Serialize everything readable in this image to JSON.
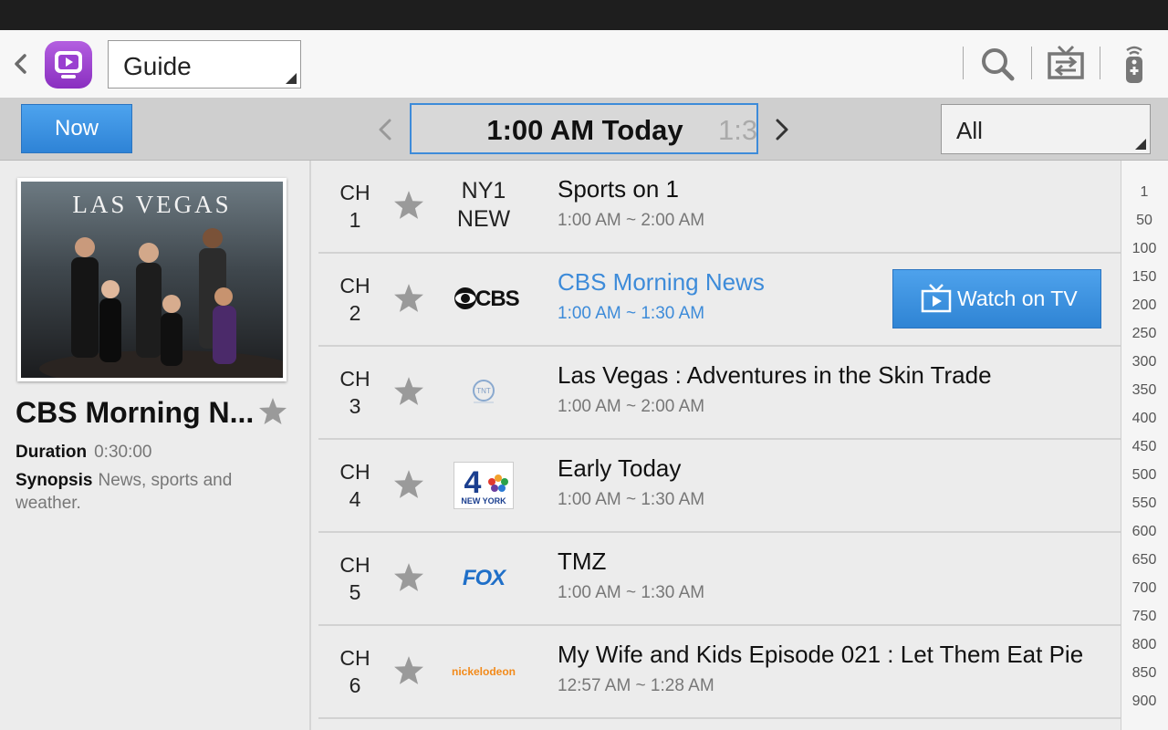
{
  "actionbar": {
    "view_select_value": "Guide"
  },
  "subbar": {
    "now_label": "Now",
    "current_time": "1:00 AM Today",
    "next_time_partial": "1:3",
    "filter_value": "All"
  },
  "detail": {
    "poster_title": "LAS VEGAS",
    "title": "CBS Morning N...",
    "duration_label": "Duration",
    "duration_value": "0:30:00",
    "synopsis_label": "Synopsis",
    "synopsis_value": "News, sports and weather."
  },
  "channels": [
    {
      "ch_label": "CH",
      "ch_num": "1",
      "logo_line1": "NY1",
      "logo_line2": "NEW",
      "title": "Sports on 1",
      "time": "1:00 AM ~ 2:00 AM"
    },
    {
      "ch_label": "CH",
      "ch_num": "2",
      "logo": "CBS",
      "title": "CBS Morning News",
      "time": "1:00 AM ~ 1:30 AM",
      "selected": true,
      "watch_label": "Watch on TV"
    },
    {
      "ch_label": "CH",
      "ch_num": "3",
      "logo": "TNT",
      "title": "Las Vegas : Adventures in the Skin Trade",
      "time": "1:00 AM ~ 2:00 AM"
    },
    {
      "ch_label": "CH",
      "ch_num": "4",
      "logo": "4",
      "logo_sub": "NEW YORK",
      "title": "Early Today",
      "time": "1:00 AM ~ 1:30 AM"
    },
    {
      "ch_label": "CH",
      "ch_num": "5",
      "logo": "FOX",
      "title": "TMZ",
      "time": "1:00 AM ~ 1:30 AM"
    },
    {
      "ch_label": "CH",
      "ch_num": "6",
      "logo": "nickelodeon",
      "title": "My Wife and Kids Episode 021 : Let Them Eat Pie",
      "time": "12:57 AM ~ 1:28 AM"
    }
  ],
  "index_bar": [
    "1",
    "50",
    "100",
    "150",
    "200",
    "250",
    "300",
    "350",
    "400",
    "450",
    "500",
    "550",
    "600",
    "650",
    "700",
    "750",
    "800",
    "850",
    "900"
  ],
  "colors": {
    "accent_blue": "#3d8bd9",
    "button_blue": "#2f84d4",
    "app_icon_purple": "#9a3fd0",
    "status_bar": "#1e1e1e"
  }
}
